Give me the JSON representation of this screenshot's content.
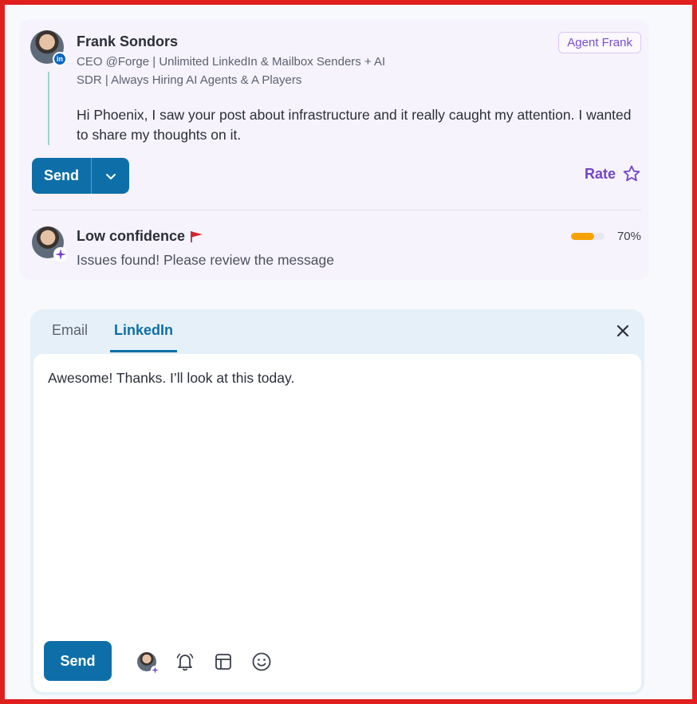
{
  "message": {
    "sender_name": "Frank Sondors",
    "sender_title": "CEO @Forge | Unlimited LinkedIn & Mailbox Senders + AI SDR | Always Hiring AI Agents & A Players",
    "channel_badge": "in",
    "agent_tag": "Agent Frank",
    "body": "Hi Phoenix, I saw your post about infrastructure and it really caught my attention. I wanted to share my thoughts on it.",
    "send_label": "Send",
    "rate_label": "Rate"
  },
  "confidence": {
    "title": "Low confidence",
    "message": "Issues found! Please review the message",
    "percent_label": "70%",
    "percent": 70,
    "bar_color": "#f5a200"
  },
  "composer": {
    "tabs": [
      {
        "label": "Email",
        "active": false
      },
      {
        "label": "LinkedIn",
        "active": true
      }
    ],
    "text": "Awesome! Thanks. I’ll look at this today.",
    "send_label": "Send",
    "toolbar_icons": [
      "agent-avatar-icon",
      "bell-icon",
      "template-icon",
      "emoji-icon"
    ]
  },
  "colors": {
    "primary": "#0e6fa8",
    "accent_purple": "#7244c8",
    "frame_border": "#e01f1f"
  }
}
